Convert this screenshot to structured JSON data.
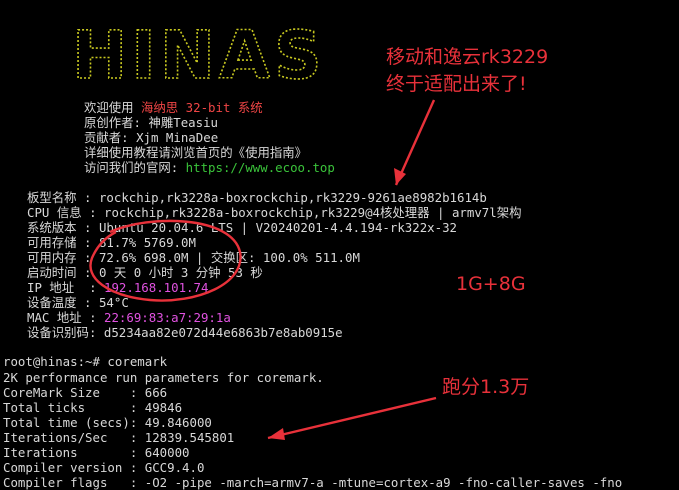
{
  "banner": {
    "text": "HINAS",
    "color": "#c8c820"
  },
  "welcome": {
    "prefix": "欢迎使用 ",
    "highlight": "海纳思 32-bit 系统",
    "author": "原创作者: 神雕Teasiu",
    "contributor": "贡献者: Xjm MinaDee",
    "guide": "详细使用教程请浏览首页的《使用指南》",
    "site_prefix": "访问我们的官网: ",
    "site_url": "https://www.ecoo.top"
  },
  "sysinfo": {
    "board": "板型名称 : rockchip,rk3228a-boxrockchip,rk3229-9261ae8982b1614b",
    "cpu": "CPU 信息 : rockchip,rk3228a-boxrockchip,rk3229@4核处理器 | armv7l架构",
    "os": "系统版本 : Ubuntu 20.04.6 LTS | V20240201-4.4.194-rk322x-32",
    "storage": "可用存储 : 81.7% 5769.0M",
    "memory": "可用内存 : 72.6% 698.0M | 交换区: 100.0% 511.0M",
    "uptime": "启动时间 : 0 天 0 小时 3 分钟 53 秒",
    "ip_label": "IP 地址  : ",
    "ip_value": "192.168.101.74",
    "temp": "设备温度 : 54°C",
    "mac_label": "MAC 地址 : ",
    "mac_value": "22:69:83:a7:29:1a",
    "device_id": "设备识别码: d5234aa82e072d44e6863b7e8ab0915e"
  },
  "coremark": {
    "prompt": "root@hinas:~# coremark",
    "params": "2K performance run parameters for coremark.",
    "size": "CoreMark Size    : 666",
    "ticks": "Total ticks      : 49846",
    "time": "Total time (secs): 49.846000",
    "iter_sec": "Iterations/Sec   : 12839.545801",
    "iterations": "Iterations       : 640000",
    "compiler_version": "Compiler version : GCC9.4.0",
    "compiler_flags": "Compiler flags   : -O2 -pipe -march=armv7-a -mtune=cortex-a9 -fno-caller-saves -fno"
  },
  "annotations": {
    "title_line1": "移动和逸云rk3229",
    "title_line2": "终于适配出来了!",
    "memory_note": "1G+8G",
    "score_note": "跑分1.3万",
    "color": "#e8313a"
  }
}
